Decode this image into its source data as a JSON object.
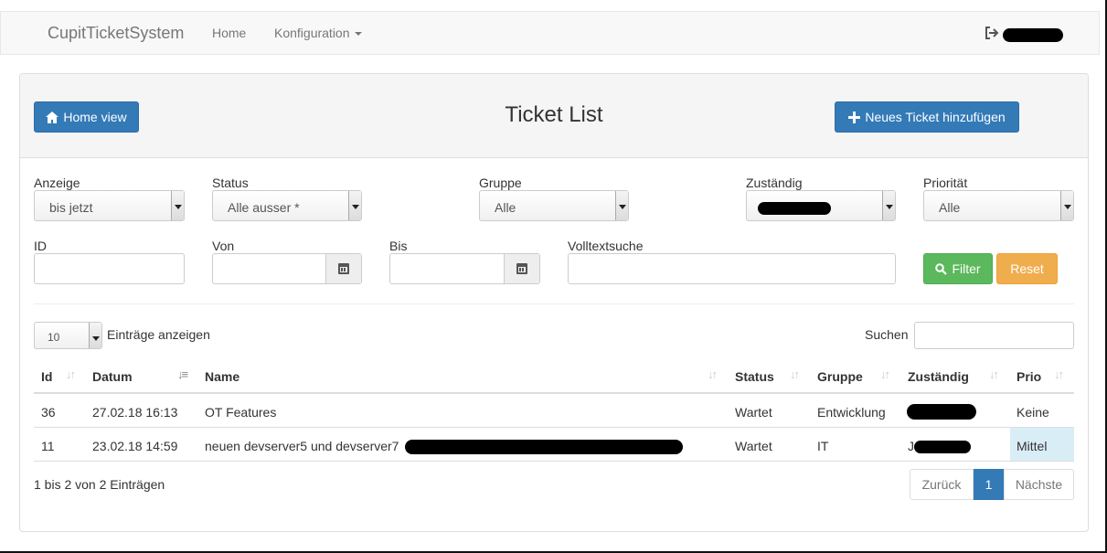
{
  "navbar": {
    "brand": "CupitTicketSystem",
    "links": [
      {
        "label": "Home"
      },
      {
        "label": "Konfiguration"
      }
    ]
  },
  "panel": {
    "home_button": "Home view",
    "title": "Ticket List",
    "new_ticket_button": "Neues Ticket hinzufügen"
  },
  "filters": {
    "anzeige": {
      "label": "Anzeige",
      "value": "bis jetzt"
    },
    "status": {
      "label": "Status",
      "value": "Alle ausser *"
    },
    "gruppe": {
      "label": "Gruppe",
      "value": "Alle"
    },
    "zustaendig": {
      "label": "Zuständig",
      "value": ""
    },
    "prioritaet": {
      "label": "Priorität",
      "value": "Alle"
    },
    "id": {
      "label": "ID",
      "value": ""
    },
    "von": {
      "label": "Von",
      "value": ""
    },
    "bis": {
      "label": "Bis",
      "value": ""
    },
    "volltext": {
      "label": "Volltextsuche",
      "value": ""
    },
    "filter_button": "Filter",
    "reset_button": "Reset"
  },
  "table_controls": {
    "page_size": "10",
    "page_size_label": "Einträge anzeigen",
    "search_label": "Suchen",
    "search_value": ""
  },
  "table": {
    "columns": [
      "Id",
      "Datum",
      "Name",
      "Status",
      "Gruppe",
      "Zuständig",
      "Prio"
    ],
    "rows": [
      {
        "id": "36",
        "datum": "27.02.18 16:13",
        "name": "OT Features",
        "status": "Wartet",
        "gruppe": "Entwicklung",
        "zustaendig": "",
        "prio": "Keine"
      },
      {
        "id": "11",
        "datum": "23.02.18 14:59",
        "name": "neuen devserver5 und devserver7",
        "status": "Wartet",
        "gruppe": "IT",
        "zustaendig": "J",
        "prio": "Mittel"
      }
    ]
  },
  "footer": {
    "info": "1 bis 2 von 2 Einträgen",
    "prev": "Zurück",
    "page": "1",
    "next": "Nächste"
  }
}
